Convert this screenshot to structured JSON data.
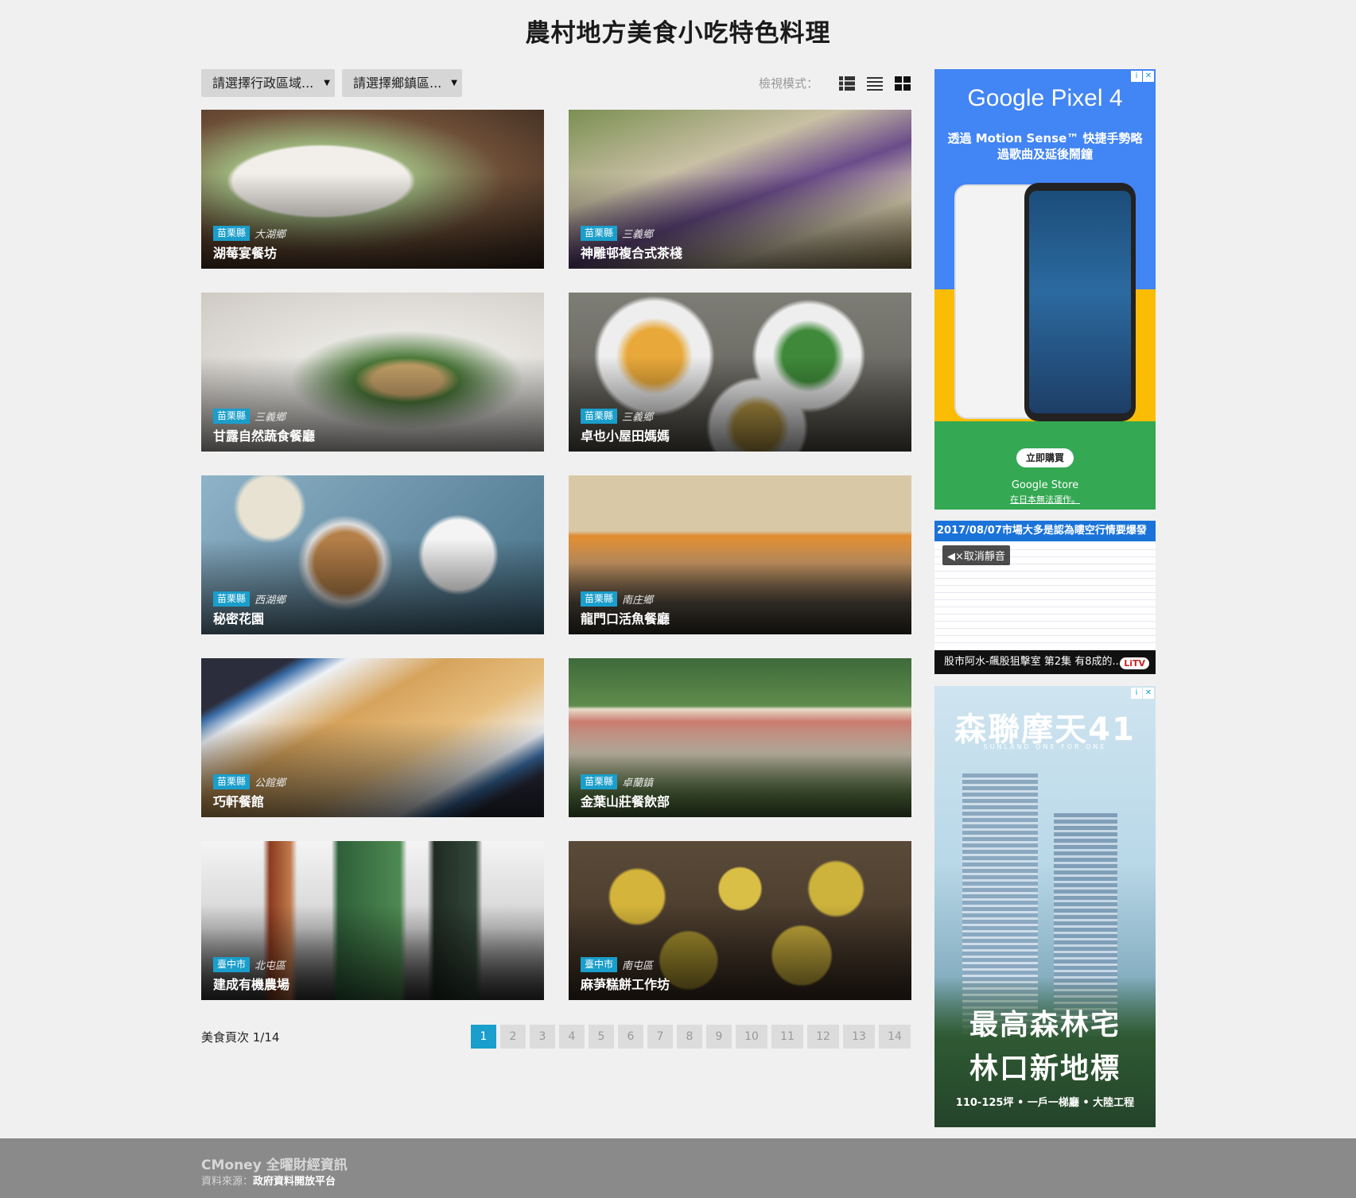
{
  "page": {
    "title": "農村地方美食小吃特色料理"
  },
  "filters": {
    "district": "請選擇行政區域...",
    "township": "請選擇鄉鎮區...",
    "view_mode_label": "檢視模式："
  },
  "items": [
    {
      "county": "苗栗縣",
      "town": "大湖鄉",
      "name": "湖莓宴餐坊"
    },
    {
      "county": "苗栗縣",
      "town": "三義鄉",
      "name": "神雕邨複合式茶棧"
    },
    {
      "county": "苗栗縣",
      "town": "三義鄉",
      "name": "甘露自然蔬食餐廳"
    },
    {
      "county": "苗栗縣",
      "town": "三義鄉",
      "name": "卓也小屋田媽媽"
    },
    {
      "county": "苗栗縣",
      "town": "西湖鄉",
      "name": "秘密花園"
    },
    {
      "county": "苗栗縣",
      "town": "南庄鄉",
      "name": "龍門口活魚餐廳"
    },
    {
      "county": "苗栗縣",
      "town": "公館鄉",
      "name": "巧軒餐館"
    },
    {
      "county": "苗栗縣",
      "town": "卓蘭鎮",
      "name": "金葉山莊餐飲部"
    },
    {
      "county": "臺中市",
      "town": "北屯區",
      "name": "建成有機農場"
    },
    {
      "county": "臺中市",
      "town": "南屯區",
      "name": "麻芛糕餅工作坊"
    }
  ],
  "pagination": {
    "info": "美食頁次 1/14",
    "pages": [
      "1",
      "2",
      "3",
      "4",
      "5",
      "6",
      "7",
      "8",
      "9",
      "10",
      "11",
      "12",
      "13",
      "14"
    ],
    "current": "1"
  },
  "ads": {
    "pixel": {
      "brand": "Google Pixel 4",
      "tagline": "透過 Motion Sense™ 快捷手勢略過歌曲及延後鬧鐘",
      "buy": "立即購買",
      "store": "Google Store",
      "store_note": "在日本無法運作。"
    },
    "video": {
      "headline": "2017/08/07市場大多是認為瞜空行情要爆發",
      "mute": "◀×取消靜音",
      "caption": "股市阿水-飆股狙擊室 第2集 有8成的...",
      "logo": "LiTV"
    },
    "realestate": {
      "brand": "森聯摩天41",
      "brand_sub": "SUNLAND ONE FOR ONE",
      "slogan1": "最高森林宅",
      "slogan2": "林口新地標",
      "specs": "110-125坪 • 一戶一梯廳 • 大陸工程"
    }
  },
  "footer": {
    "brand": "CMoney 全曜財經資訊",
    "source_label": "資料來源：",
    "source_value": "政府資料開放平台"
  }
}
